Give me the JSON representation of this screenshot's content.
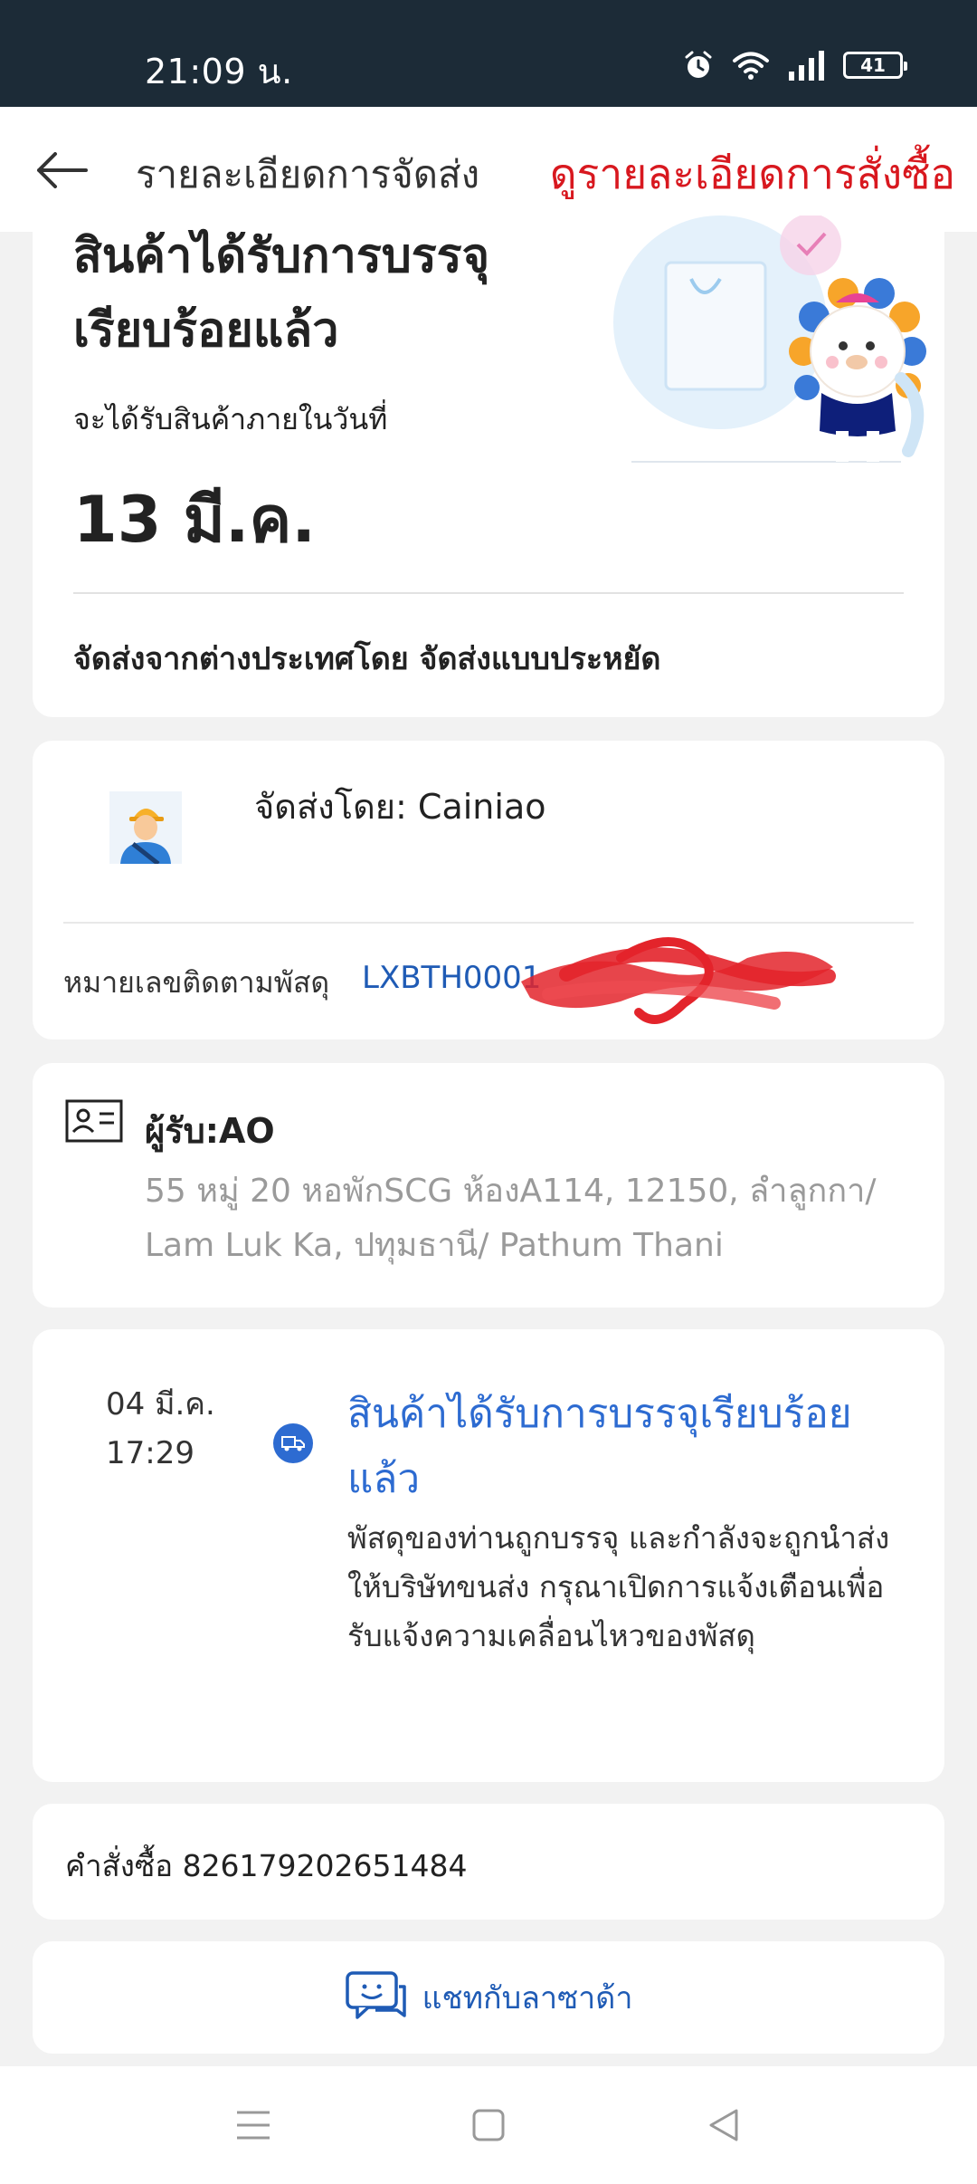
{
  "status_bar": {
    "time": "21:09 น.",
    "battery": "41",
    "icons": [
      "alarm-icon",
      "wifi-icon",
      "signal-icon",
      "battery-icon"
    ]
  },
  "header": {
    "title": "รายละเอียดการจัดส่ง",
    "order_detail_link": "ดูรายละเอียดการสั่งซื้อ",
    "back_icon": "arrow-left-icon"
  },
  "delivery_status": {
    "title": "สินค้าได้รับการบรรจุเรียบร้อยแล้ว",
    "eta_label": "จะได้รับสินค้าภายในวันที่",
    "eta_date": "13 มี.ค.",
    "shipping_method": "จัดส่งจากต่างประเทศโดย จัดส่งแบบประหยัด"
  },
  "carrier": {
    "label": "จัดส่งโดย: Cainiao",
    "tracking_label": "หมายเลขติดตามพัสดุ",
    "tracking_number": "LXBTH0001"
  },
  "recipient": {
    "name": "ผู้รับ:AO",
    "address": "55 หมู่ 20 หอพักSCG ห้องA114, 12150, ลำลูกกา/ Lam Luk Ka, ปทุมธานี/ Pathum Thani"
  },
  "timeline": [
    {
      "date": "04 มี.ค.",
      "time": "17:29",
      "title": "สินค้าได้รับการบรรจุเรียบร้อยแล้ว",
      "description": "พัสดุของท่านถูกบรรจุ และกำลังจะถูกนำส่งให้บริษัทขนส่ง กรุณาเปิดการแจ้งเตือนเพื่อรับแจ้งความเคลื่อนไหวของพัสดุ"
    }
  ],
  "order": {
    "label": "คำสั่งซื้อ 826179202651484"
  },
  "chat": {
    "label": "แชทกับลาซาด้า"
  },
  "colors": {
    "status_bar": "#1c2b37",
    "accent_red": "#d8181f",
    "link_blue": "#1f5bb5",
    "timeline_blue": "#2d6bd1",
    "background": "#f2f2f2"
  }
}
